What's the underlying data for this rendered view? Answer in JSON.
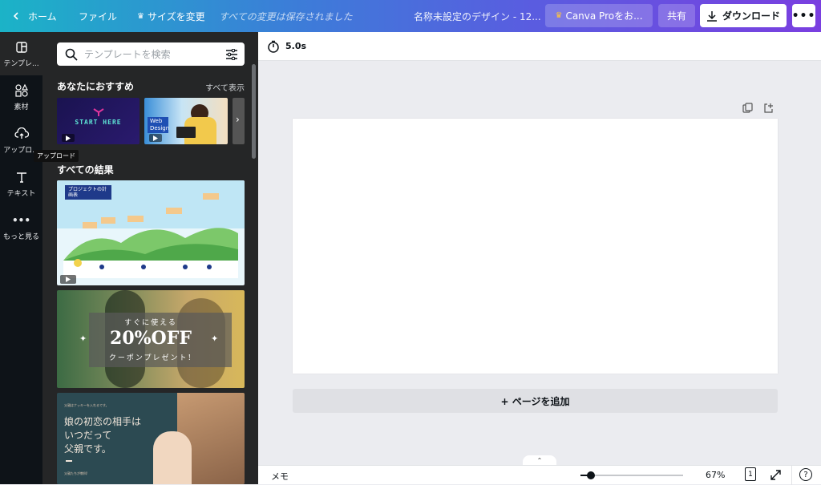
{
  "topbar": {
    "home": "ホーム",
    "file": "ファイル",
    "resize": "サイズを変更",
    "saved_status": "すべての変更は保存されました",
    "doc_title": "名称未設定のデザイン - 12...",
    "canva_pro": "Canva Proをお...",
    "share": "共有",
    "download": "ダウンロード"
  },
  "rail": {
    "items": [
      {
        "label": "テンプレ...",
        "icon": "template-icon"
      },
      {
        "label": "素材",
        "icon": "elements-icon"
      },
      {
        "label": "アップロ...",
        "icon": "upload-cloud-icon"
      },
      {
        "label": "テキスト",
        "icon": "text-icon"
      },
      {
        "label": "もっと見る",
        "icon": "more-dots-icon"
      }
    ],
    "tooltip": "アップロード"
  },
  "panel": {
    "search_placeholder": "テンプレートを検索",
    "recommended_title": "あなたにおすすめ",
    "see_all": "すべて表示",
    "all_results_title": "すべての結果",
    "recommended": [
      {
        "text": "START HERE"
      },
      {
        "text": "Web Design"
      }
    ],
    "results": [
      {
        "title": "プロジェクトの計画表"
      },
      {
        "line1": "すぐに使える",
        "big": "20%OFF",
        "line2": "クーポンプレゼント!"
      },
      {
        "small": "父親はナッキーを入れるです。",
        "line1": "娘の初恋の相手は",
        "line2": "いつだって",
        "line3": "父親です。",
        "footer": "父親たちが教科!"
      }
    ]
  },
  "canvas": {
    "duration": "5.0s",
    "add_page": "+ ページを追加"
  },
  "bottombar": {
    "memo": "メモ",
    "zoom": "67%",
    "page_count": "1",
    "zoom_level": 0.1
  }
}
